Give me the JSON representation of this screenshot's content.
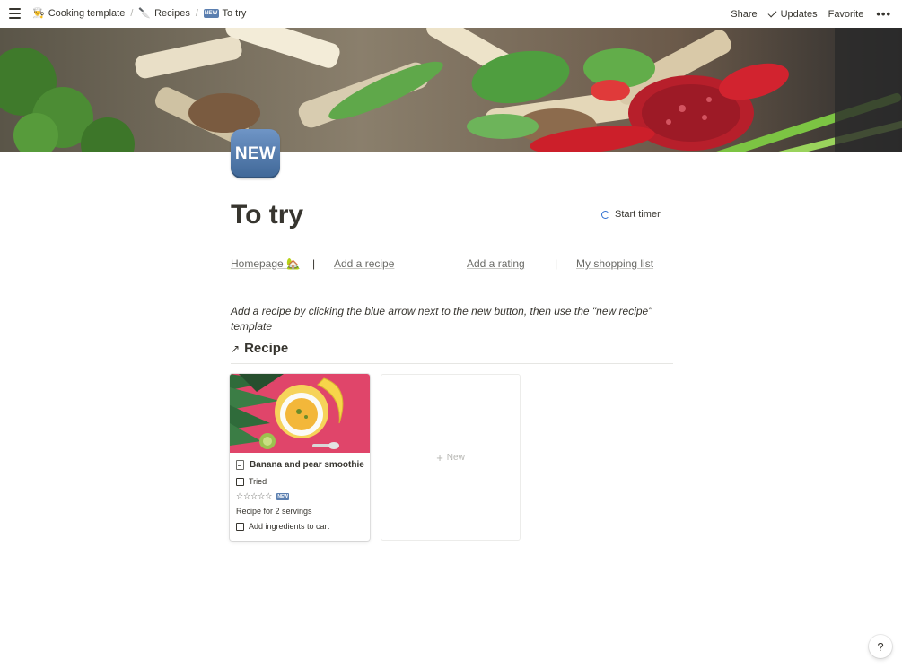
{
  "breadcrumb": {
    "items": [
      {
        "icon": "cook-emoji",
        "label": "Cooking template"
      },
      {
        "icon": "knife-icon",
        "label": "Recipes"
      },
      {
        "icon": "new-badge",
        "label": "To try"
      }
    ],
    "new_badge_text": "NEW"
  },
  "topbar": {
    "share": "Share",
    "updates": "Updates",
    "favorite": "Favorite",
    "more": "•••"
  },
  "page": {
    "icon_text": "NEW",
    "title": "To try",
    "timer_label": "Start timer"
  },
  "links": {
    "homepage": "Homepage 🏡",
    "add_recipe": "Add a recipe",
    "add_rating": "Add a rating",
    "shopping_list": "My shopping list",
    "separator": "|"
  },
  "instructions": "Add a recipe by clicking the blue arrow next to the new button, then use the \"new recipe\" template",
  "database": {
    "arrow": "↗",
    "title": "Recipe",
    "cards": [
      {
        "title": "Banana and pear smoothie",
        "tried_label": "Tried",
        "tried": false,
        "rating_stars": "☆☆☆☆☆",
        "rating_badge": "NEW",
        "servings": "Recipe for 2 servings",
        "cart_label": "Add ingredients to cart",
        "cart": false
      }
    ],
    "new_label": "New"
  },
  "help": "?",
  "colors": {
    "text": "#37352f",
    "muted": "#6b6b67",
    "badge_blue": "#5b7fb0",
    "card_bg_pink": "#e0456a",
    "card_bg_yellow": "#f2c94c"
  }
}
